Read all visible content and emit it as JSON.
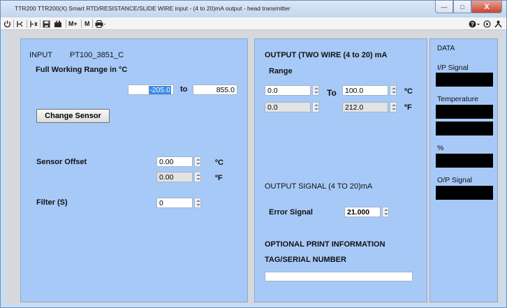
{
  "window": {
    "title": "TTR200 TTR200(X) Smart RTD/RESISTANCE/SLIDE WIRE input - (4 to 20)mA output - head transmitter",
    "minimize": "—",
    "maximize": "□",
    "close": "X"
  },
  "toolbar": {
    "memory_plus": "M+",
    "memory": "M"
  },
  "input": {
    "heading": "INPUT",
    "sensor_name": "PT100_3851_C",
    "range_label": "Full Working Range in °C",
    "range_min": "-205.0",
    "range_to": "to",
    "range_max": "855.0",
    "change_sensor": "Change Sensor",
    "offset_label": "Sensor Offset",
    "offset_c": "0.00",
    "offset_c_unit": "ºC",
    "offset_f": "0.00",
    "offset_f_unit": "ºF",
    "filter_label": "Filter (S)",
    "filter_value": "0"
  },
  "output": {
    "heading": "OUTPUT (TWO WIRE (4 to 20) mA",
    "range_label": "Range",
    "low_c": "0.0",
    "to": "To",
    "high_c": "100.0",
    "unit_c": "ºC",
    "low_f": "0.0",
    "high_f": "212.0",
    "unit_f": "ºF",
    "signal_heading": "OUTPUT SIGNAL (4 TO 20)mA",
    "error_label": "Error Signal",
    "error_value": "21.000",
    "print_heading": "OPTIONAL PRINT INFORMATION",
    "tag_label": "TAG/SERIAL NUMBER",
    "tag_value": ""
  },
  "data_panel": {
    "heading": "DATA",
    "ip_signal": "I/P  Signal",
    "temperature": "Temperature",
    "percent": "%",
    "op_signal": "O/P Signal"
  }
}
